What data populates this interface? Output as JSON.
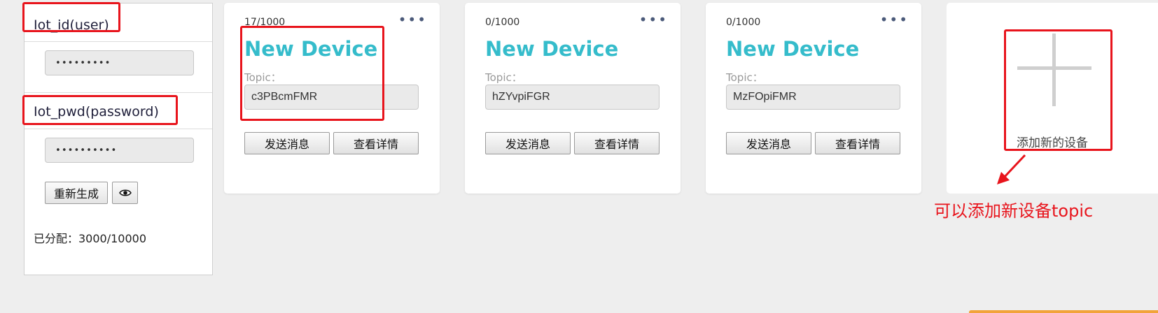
{
  "credentials": {
    "id_label": "Iot_id(user)",
    "id_value": "•••••••••",
    "pwd_label": "Iot_pwd(password)",
    "pwd_value": "••••••••••",
    "regenerate_label": "重新生成",
    "eye_icon": "eye-icon",
    "allocated_text": "已分配：3000/10000"
  },
  "devices": [
    {
      "count": "17/1000",
      "title": "New Device",
      "topic_label": "Topic：",
      "topic": "c3PBcmFMR",
      "send_label": "发送消息",
      "detail_label": "查看详情",
      "menu": "•••"
    },
    {
      "count": "0/1000",
      "title": "New Device",
      "topic_label": "Topic：",
      "topic": "hZYvpiFGR",
      "send_label": "发送消息",
      "detail_label": "查看详情",
      "menu": "•••"
    },
    {
      "count": "0/1000",
      "title": "New Device",
      "topic_label": "Topic：",
      "topic": "MzFOpiFMR",
      "send_label": "发送消息",
      "detail_label": "查看详情",
      "menu": "•••"
    }
  ],
  "add_card": {
    "label": "添加新的设备",
    "icon": "plus-icon"
  },
  "annotation": {
    "text": "可以添加新设备topic"
  },
  "colors": {
    "accent": "#35bccb",
    "annotation_red": "#e8141c",
    "background": "#eeeeee"
  }
}
